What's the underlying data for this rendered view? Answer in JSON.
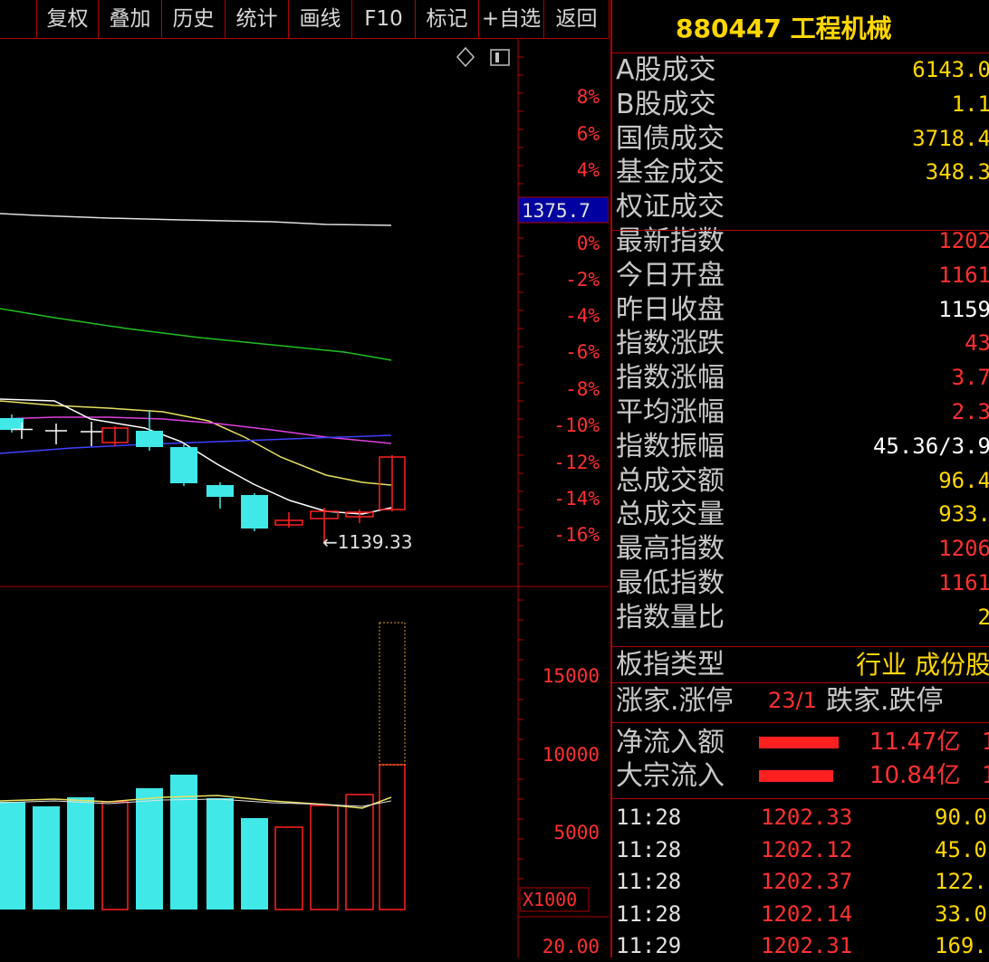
{
  "toolbar": {
    "items": [
      "复权",
      "叠加",
      "历史",
      "统计",
      "画线",
      "F10",
      "标记",
      "+自选",
      "返回"
    ]
  },
  "chart": {
    "pct_labels": [
      "8%",
      "6%",
      "4%",
      "0%",
      "-2%",
      "-4%",
      "-6%",
      "-8%",
      "-10%",
      "-12%",
      "-14%",
      "-16%"
    ],
    "price_marker": "1375.7",
    "low_annotation": "←1139.33",
    "volume_labels": [
      "15000",
      "10000",
      "5000"
    ],
    "volume_unit": "X1000",
    "bottom_label": "20.00",
    "icons": [
      "diamond-icon",
      "square-icon"
    ],
    "colors": {
      "up": "#ff2020",
      "down": "#40e8e8",
      "ma_white": "#e0e0e0",
      "ma_green": "#20c020",
      "ma_yellow": "#e8e060",
      "ma_magenta": "#e040e0",
      "ma_blue": "#4040ff",
      "grid": "#b00000"
    }
  },
  "panel": {
    "title": "880447 工程机械",
    "rows": [
      {
        "label": "A股成交",
        "value": "6143.0",
        "color": "yellow"
      },
      {
        "label": "B股成交",
        "value": "1.1",
        "color": "yellow"
      },
      {
        "label": "国债成交",
        "value": "3718.4",
        "color": "yellow"
      },
      {
        "label": "基金成交",
        "value": "348.3",
        "color": "yellow"
      },
      {
        "label": "权证成交",
        "value": "",
        "color": "yellow"
      },
      {
        "label": "最新指数",
        "value": "1202",
        "color": "red"
      },
      {
        "label": "今日开盘",
        "value": "1161",
        "color": "red"
      },
      {
        "label": "昨日收盘",
        "value": "1159",
        "color": "white"
      },
      {
        "label": "指数涨跌",
        "value": "43",
        "color": "red"
      },
      {
        "label": "指数涨幅",
        "value": "3.7",
        "color": "red"
      },
      {
        "label": "平均涨幅",
        "value": "2.3",
        "color": "red"
      },
      {
        "label": "指数振幅",
        "value": "45.36/3.9",
        "color": "white"
      },
      {
        "label": "总成交额",
        "value": "96.4",
        "color": "yellow"
      },
      {
        "label": "总成交量",
        "value": "933.",
        "color": "yellow"
      },
      {
        "label": "最高指数",
        "value": "1206",
        "color": "red"
      },
      {
        "label": "最低指数",
        "value": "1161",
        "color": "red"
      },
      {
        "label": "指数量比",
        "value": "2",
        "color": "yellow"
      }
    ],
    "board_type": {
      "label": "板指类型",
      "value": "行业 成份股"
    },
    "updown": {
      "label1": "涨家.涨停",
      "value1": "23/1",
      "label2": "跌家.跌停"
    },
    "flows": [
      {
        "label": "净流入额",
        "value": "11.47亿",
        "extra": "1"
      },
      {
        "label": "大宗流入",
        "value": "10.84亿",
        "extra": "1"
      }
    ],
    "ticks": [
      {
        "time": "11:28",
        "price": "1202.33",
        "vol": "90.0"
      },
      {
        "time": "11:28",
        "price": "1202.12",
        "vol": "45.0"
      },
      {
        "time": "11:28",
        "price": "1202.37",
        "vol": "122."
      },
      {
        "time": "11:28",
        "price": "1202.14",
        "vol": "33.0"
      },
      {
        "time": "11:29",
        "price": "1202.31",
        "vol": "169."
      }
    ]
  }
}
